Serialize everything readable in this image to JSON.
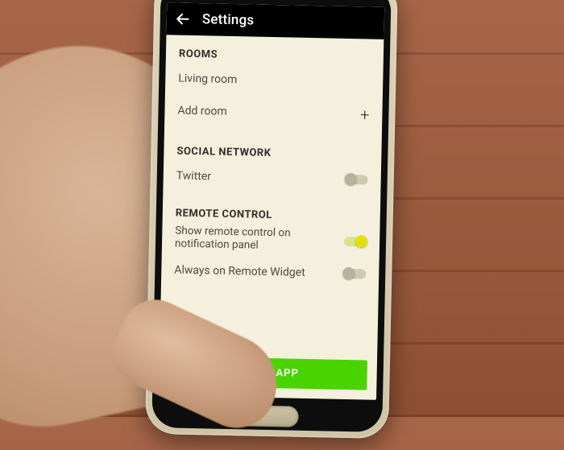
{
  "appbar": {
    "title": "Settings"
  },
  "sections": {
    "rooms": {
      "header": "ROOMS",
      "item0": "Living room",
      "add_label": "Add room"
    },
    "social": {
      "header": "SOCIAL NETWORK",
      "twitter_label": "Twitter",
      "twitter_on": "off"
    },
    "remote": {
      "header": "REMOTE CONTROL",
      "show_label": "Show remote control on notification panel",
      "show_on": "on",
      "always_label": "Always on Remote Widget",
      "always_on": "off"
    }
  },
  "footer": {
    "reset_label": "RESET APP"
  }
}
